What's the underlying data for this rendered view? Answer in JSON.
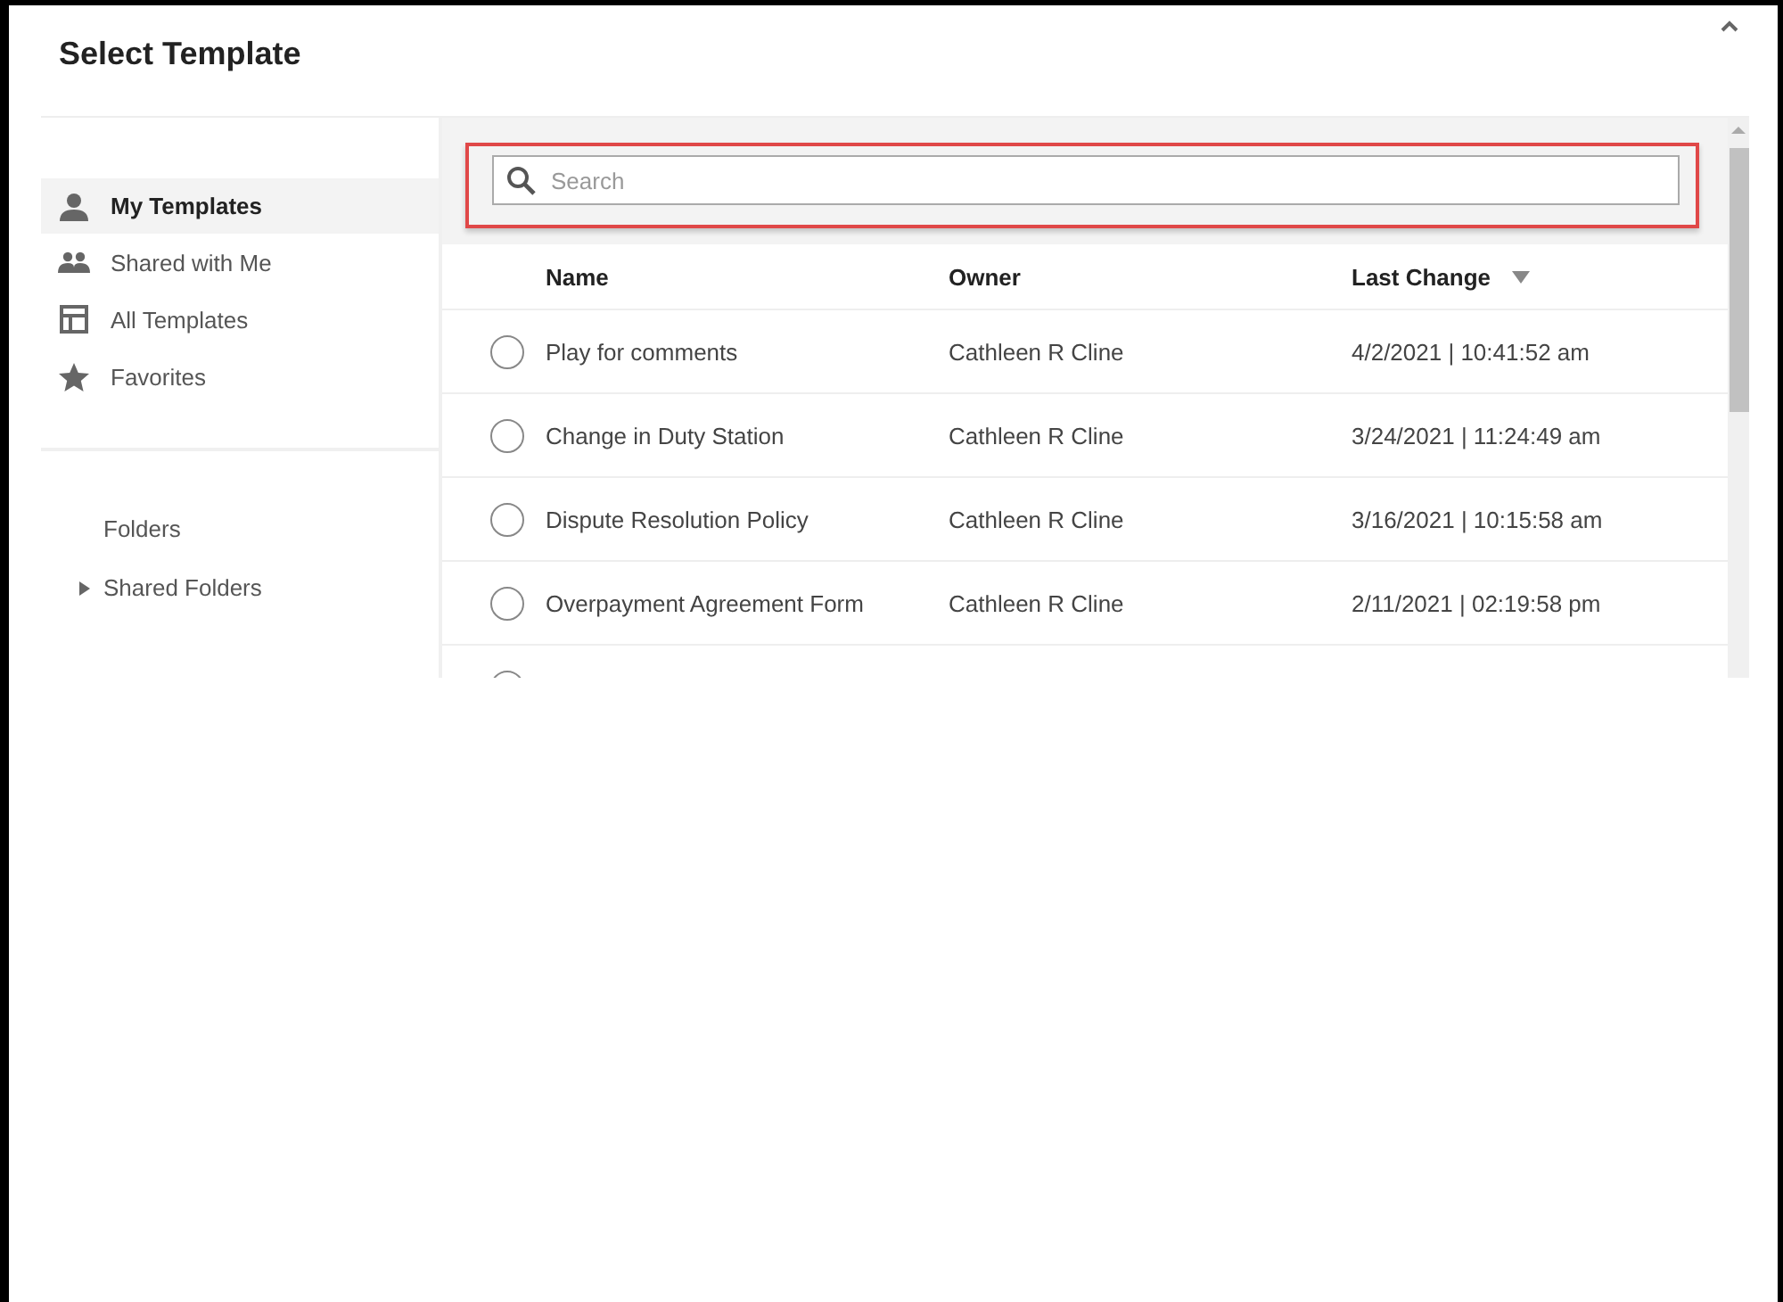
{
  "dialog": {
    "title": "Select Template"
  },
  "sidebar": {
    "items": [
      {
        "label": "My Templates",
        "kind": "person",
        "selected": true
      },
      {
        "label": "Shared with Me",
        "kind": "people",
        "selected": false
      },
      {
        "label": "All Templates",
        "kind": "layout",
        "selected": false
      },
      {
        "label": "Favorites",
        "kind": "star",
        "selected": false
      }
    ],
    "folders_heading": "Folders",
    "folders": [
      {
        "label": "Shared Folders",
        "expanded": false
      }
    ]
  },
  "search": {
    "placeholder": "Search",
    "highlighted": true
  },
  "table": {
    "columns": [
      {
        "label": "Name",
        "sorted_descending": false
      },
      {
        "label": "Owner",
        "sorted_descending": false
      },
      {
        "label": "Last Change",
        "sorted_descending": true
      }
    ],
    "rows": [
      {
        "selected": false,
        "name": "Play for comments",
        "owner": "Cathleen R Cline",
        "last_change": "4/2/2021 | 10:41:52 am"
      },
      {
        "selected": false,
        "name": "Change in Duty Station",
        "owner": "Cathleen R Cline",
        "last_change": "3/24/2021 | 11:24:49 am"
      },
      {
        "selected": false,
        "name": "Dispute Resolution Policy",
        "owner": "Cathleen R Cline",
        "last_change": "3/16/2021 | 10:15:58 am"
      },
      {
        "selected": false,
        "name": "Overpayment Agreement Form",
        "owner": "Cathleen R Cline",
        "last_change": "2/11/2021 | 02:19:58 pm"
      },
      {
        "selected": false
      }
    ]
  }
}
